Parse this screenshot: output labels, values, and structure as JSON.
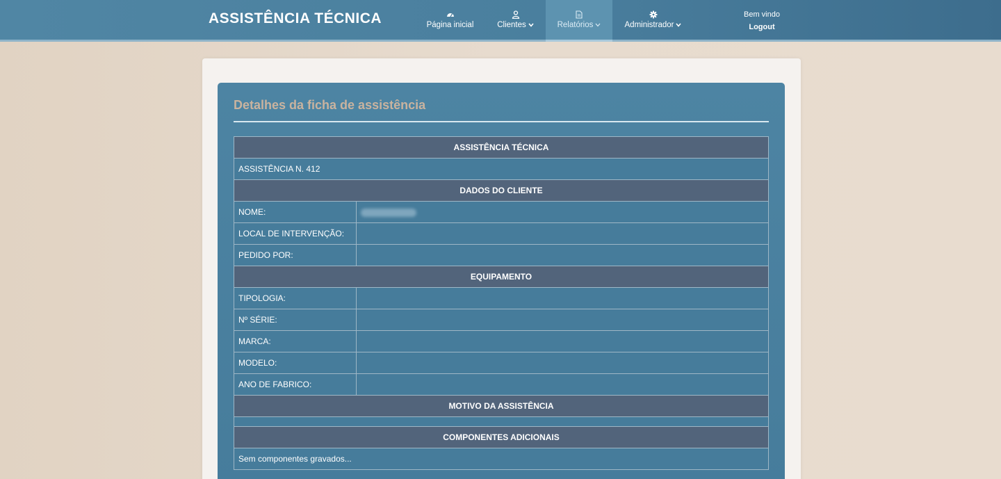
{
  "header": {
    "brand": "ASSISTÊNCIA TÉCNICA",
    "nav": [
      {
        "label": "Página inicial",
        "icon": "dashboard-icon",
        "dropdown": false
      },
      {
        "label": "Clientes",
        "icon": "user-icon",
        "dropdown": true
      },
      {
        "label": "Relatórios",
        "icon": "file-icon",
        "dropdown": true,
        "active": true
      },
      {
        "label": "Administrador",
        "icon": "gear-icon",
        "dropdown": true
      }
    ],
    "user": {
      "greeting": "Bem vindo",
      "logout": "Logout"
    }
  },
  "card": {
    "title": "Detalhes da ficha de assistência"
  },
  "table": {
    "section_main": "ASSISTÊNCIA TÉCNICA",
    "assistance_number": "ASSISTÊNCIA N. 412",
    "section_client": "DADOS DO CLIENTE",
    "client_rows": [
      {
        "label": "NOME:",
        "value": ""
      },
      {
        "label": "LOCAL DE INTERVENÇÃO:",
        "value": ""
      },
      {
        "label": "PEDIDO POR:",
        "value": ""
      }
    ],
    "section_equipment": "EQUIPAMENTO",
    "equipment_rows": [
      {
        "label": "TIPOLOGIA:",
        "value": ""
      },
      {
        "label": "Nº SÉRIE:",
        "value": ""
      },
      {
        "label": "MARCA:",
        "value": ""
      },
      {
        "label": "MODELO:",
        "value": ""
      },
      {
        "label": "ANO DE FABRICO:",
        "value": ""
      }
    ],
    "section_reason": "MOTIVO DA ASSISTÊNCIA",
    "reason_value": "",
    "section_components": "COMPONENTES ADICIONAIS",
    "components_empty": "Sem componentes gravados..."
  },
  "colors": {
    "navbar": "#4a7f9e",
    "header_cell": "#52647b",
    "card": "#467c9b",
    "title": "#c9b39f"
  }
}
